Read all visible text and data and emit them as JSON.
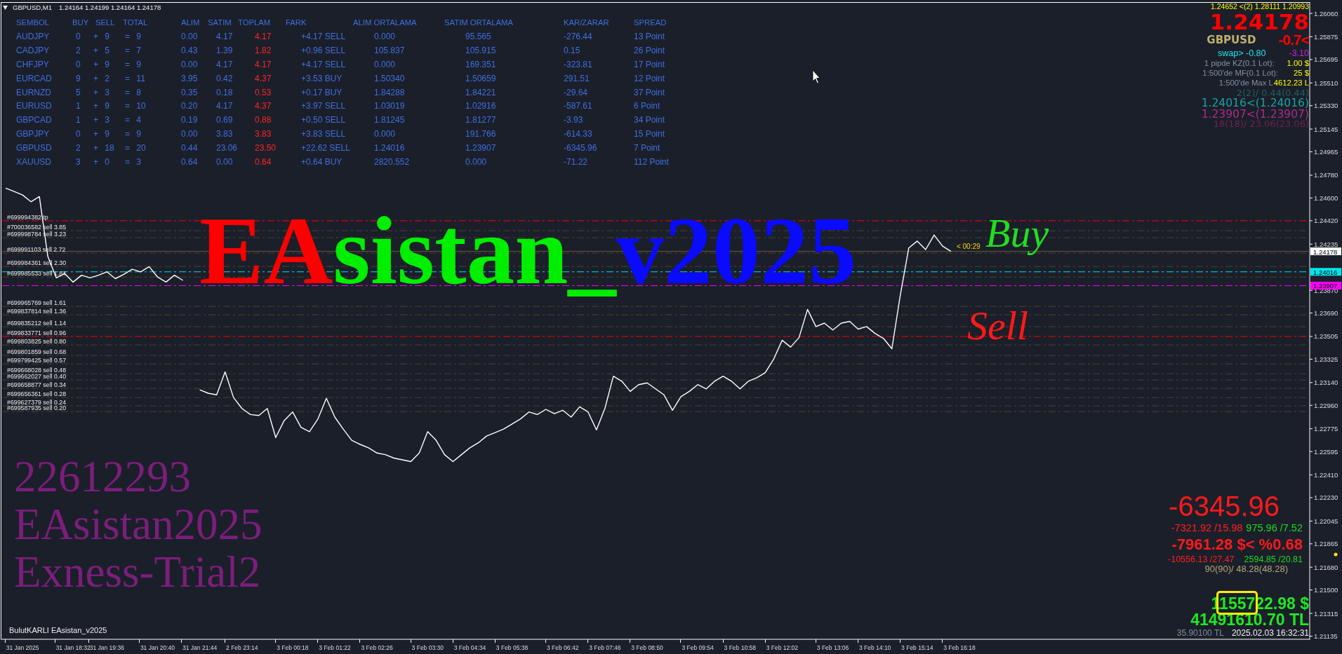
{
  "chart_header": {
    "symbol": "GBPUSD,M1",
    "ohlc": "1.24164 1.24199 1.24164 1.24178"
  },
  "positions_table": {
    "columns": [
      "SEMBOL",
      "BUY",
      "SELL",
      "TOTAL",
      "ALIM",
      "SATIM",
      "TOPLAM",
      "FARK",
      "ALIM ORTALAMA",
      "SATIM ORTALAMA",
      "KAR/ZARAR",
      "SPREAD"
    ],
    "rows": [
      {
        "cells": [
          "AUDJPY",
          "0",
          "+ 9",
          "= 9",
          "0.00",
          "4.17",
          "4.17",
          "+4.17 SELL",
          "0.000",
          "95.565",
          "-276.44",
          "13 Point"
        ]
      },
      {
        "cells": [
          "CADJPY",
          "2",
          "+ 5",
          "= 7",
          "0.43",
          "1.39",
          "1.82",
          "+0.96 SELL",
          "105.837",
          "105.915",
          "0.15",
          "26 Point"
        ]
      },
      {
        "cells": [
          "CHFJPY",
          "0",
          "+ 9",
          "= 9",
          "0.00",
          "4.17",
          "4.17",
          "+4.17 SELL",
          "0.000",
          "169.351",
          "-323.81",
          "17 Point"
        ]
      },
      {
        "cells": [
          "EURCAD",
          "9",
          "+ 2",
          "= 11",
          "3.95",
          "0.42",
          "4.37",
          "+3.53 BUY",
          "1.50340",
          "1.50659",
          "291.51",
          "12 Point"
        ]
      },
      {
        "cells": [
          "EURNZD",
          "5",
          "+ 3",
          "= 8",
          "0.35",
          "0.18",
          "0.53",
          "+0.17 BUY",
          "1.84288",
          "1.84221",
          "-29.64",
          "37 Point"
        ]
      },
      {
        "cells": [
          "EURUSD",
          "1",
          "+ 9",
          "= 10",
          "0.20",
          "4.17",
          "4.37",
          "+3.97 SELL",
          "1.03019",
          "1.02916",
          "-587.61",
          "6 Point"
        ]
      },
      {
        "cells": [
          "GBPCAD",
          "1",
          "+ 3",
          "= 4",
          "0.19",
          "0.69",
          "0.88",
          "+0.50 SELL",
          "1.81245",
          "1.81277",
          "-3.93",
          "34 Point"
        ]
      },
      {
        "cells": [
          "GBPJPY",
          "0",
          "+ 9",
          "= 9",
          "0.00",
          "3.83",
          "3.83",
          "+3.83 SELL",
          "0.000",
          "191.766",
          "-614.33",
          "15 Point"
        ]
      },
      {
        "cells": [
          "GBPUSD",
          "2",
          "+ 18",
          "= 20",
          "0.44",
          "23.06",
          "23.50",
          "+22.62 SELL",
          "1.24016",
          "1.23907",
          "-6345.96",
          "7 Point"
        ]
      },
      {
        "cells": [
          "XAUUSD",
          "3",
          "+ 0",
          "= 3",
          "0.64",
          "0.00",
          "0.64",
          "+0.64 BUY",
          "2820.552",
          "0.000",
          "-71.22",
          "112 Point"
        ]
      }
    ]
  },
  "symbol_panel": {
    "range_line": "1.24652 <(2) 1.28111 1.20993",
    "price": "1.24178",
    "symbol": "GBPUSD",
    "daily_change": "-0.7<",
    "swap_long": "swap> -0.80",
    "swap_short": "-3.10",
    "rows": [
      {
        "label": "1 pipde KZ(0.1 Lot):",
        "value": "1.00 $"
      },
      {
        "label": "1:500'de MF(0.1 Lot):",
        "value": "25 $"
      },
      {
        "label": "1:500'de Max L",
        "value": "4612.23 L"
      }
    ],
    "buy_summary": "2(2)/ 0.44(0.44)",
    "buy_average": "1.24016<(1.24016)",
    "sell_average": "1.23907<(1.23907)",
    "sell_summary": "18(18)/ 23.06(23.06)"
  },
  "chart_title": {
    "parts": [
      {
        "text": "EA",
        "color": "#ff0000"
      },
      {
        "text": "sistan_",
        "color": "#00ee00"
      },
      {
        "text": "v2025",
        "color": "#0a0aff"
      }
    ]
  },
  "handwritten_notes": [
    {
      "text": "Buy",
      "color": "#22dd22"
    },
    {
      "text": "Sell",
      "color": "#ff1a1a"
    }
  ],
  "chart": {
    "countdown": "< 00:29",
    "price_tags": [
      "1.24178",
      "1.24016",
      "1.23907"
    ],
    "chart_data": {
      "type": "line",
      "ylim": [
        1.2111,
        1.26149
      ],
      "categories": [
        null,
        null,
        "31 Jan 2025",
        null,
        null,
        null,
        null,
        null,
        "31 Jan 18:32",
        null,
        null,
        null,
        "31 Jan 19:36",
        null,
        null,
        null,
        null,
        null,
        "31 Jan 20:40",
        null,
        null,
        null,
        null,
        "31 Jan 21:44",
        null,
        null,
        null,
        null,
        "2 Feb 23:14",
        null,
        null,
        null,
        null,
        null,
        "3 Feb 00:18",
        null,
        null,
        null,
        null,
        "3 Feb 01:22",
        null,
        null,
        null,
        null,
        "3 Feb 02:26",
        null,
        null,
        null,
        null,
        null,
        "3 Feb 03:30",
        null,
        null,
        null,
        null,
        "3 Feb 04:34",
        null,
        null,
        null,
        null,
        "3 Feb 05:38",
        null,
        null,
        null,
        null,
        null,
        "3 Feb 06:42",
        null,
        null,
        null,
        null,
        "3 Feb 07:46",
        null,
        null,
        null,
        null,
        "3 Feb 08:50",
        null,
        null,
        null,
        null,
        null,
        "3 Feb 09:54",
        null,
        null,
        null,
        null,
        "3 Feb 10:58",
        null,
        null,
        null,
        null,
        "3 Feb 12:02",
        null,
        null,
        null,
        null,
        null,
        "3 Feb 13:06",
        null,
        null,
        null,
        null,
        "3 Feb 14:10",
        null,
        null,
        null,
        null,
        "3 Feb 15:14",
        null,
        null,
        null,
        null,
        "3 Feb 16:18",
        null,
        null,
        null,
        null,
        null,
        null,
        null,
        null,
        null,
        null,
        null,
        null,
        null,
        null,
        null,
        null,
        null,
        null,
        null,
        null,
        null,
        null,
        null,
        null,
        null,
        null,
        null,
        null,
        null,
        null,
        null,
        null,
        null,
        null,
        null,
        null,
        null,
        null,
        null,
        null,
        null
      ],
      "yticks": [
        {
          "value": 1.2606,
          "label": "1.26060"
        },
        {
          "value": 1.25875,
          "label": "1.25875"
        },
        {
          "value": 1.25695,
          "label": "1.25695"
        },
        {
          "value": 1.2551,
          "label": "1.25510"
        },
        {
          "value": 1.2533,
          "label": "1.25330"
        },
        {
          "value": 1.25145,
          "label": "1.25145"
        },
        {
          "value": 1.24965,
          "label": "1.24965"
        },
        {
          "value": 1.2478,
          "label": "1.24780"
        },
        {
          "value": 1.246,
          "label": "1.24600"
        },
        {
          "value": 1.2442,
          "label": "1.24420"
        },
        {
          "value": 1.24235,
          "label": "1.24235"
        },
        {
          "value": 1.2387,
          "label": "1.23870"
        },
        {
          "value": 1.2369,
          "label": "1.23690"
        },
        {
          "value": 1.23505,
          "label": "1.23505"
        },
        {
          "value": 1.23325,
          "label": "1.23325"
        },
        {
          "value": 1.2314,
          "label": "1.23140"
        },
        {
          "value": 1.2296,
          "label": "1.22960"
        },
        {
          "value": 1.22775,
          "label": "1.22775"
        },
        {
          "value": 1.22595,
          "label": "1.22595"
        },
        {
          "value": 1.2241,
          "label": "1.22410"
        },
        {
          "value": 1.2223,
          "label": "1.22230"
        },
        {
          "value": 1.22045,
          "label": "1.22045"
        },
        {
          "value": 1.21865,
          "label": "1.21865"
        },
        {
          "value": 1.2168,
          "label": "1.21680"
        },
        {
          "value": 1.215,
          "label": "1.21500"
        },
        {
          "value": 1.21315,
          "label": "1.21315"
        },
        {
          "value": 1.21135,
          "label": "1.21135"
        }
      ],
      "series": [
        {
          "color": "#ffffff",
          "values": [
            1.24678,
            1.24651,
            1.24624,
            1.2457,
            1.24611,
            1.24138,
            1.23969,
            1.24002,
            1.23935,
            1.23989,
            1.23969,
            1.23989,
            1.24016,
            1.23962,
            1.23996,
            1.24036,
            1.24016,
            1.24057,
            1.23975,
            1.23935,
            1.23989,
            1.23948,
            null,
            1.23083,
            1.23056,
            1.23043,
            1.23225,
            1.23022,
            1.22935,
            1.22887,
            1.2288,
            1.22935,
            1.22705,
            1.2284,
            1.22908,
            1.22786,
            1.22752,
            1.22853,
            1.23016,
            1.22867,
            1.22772,
            1.22684,
            1.22651,
            1.22624,
            1.22583,
            1.2257,
            1.22543,
            1.22529,
            1.22515,
            1.22583,
            1.22752,
            1.22684,
            1.2257,
            1.22515,
            1.2257,
            1.22624,
            1.22664,
            1.22718,
            1.22745,
            1.22772,
            1.22813,
            1.22853,
            1.22908,
            1.22887,
            1.22928,
            1.22894,
            1.22921,
            1.22867,
            1.22948,
            1.22908,
            1.22766,
            1.22935,
            1.23191,
            1.23151,
            1.2307,
            1.23124,
            1.23137,
            1.2309,
            1.23043,
            1.22921,
            1.23029,
            1.2307,
            1.23124,
            1.2309,
            1.23151,
            1.23191,
            1.23151,
            1.2309,
            1.23151,
            1.23178,
            1.23218,
            1.23327,
            1.23475,
            1.23421,
            1.23496,
            1.23719,
            1.23583,
            1.2361,
            1.23556,
            1.2361,
            1.23624,
            1.23563,
            1.23583,
            1.23529,
            1.23489,
            1.23408,
            1.23833,
            1.24205,
            1.24259,
            1.24192,
            1.24307,
            1.24219,
            1.24178,
            null,
            null,
            null,
            null,
            null,
            null,
            null,
            null,
            null,
            null,
            null,
            null,
            null,
            null,
            null,
            null,
            null,
            null,
            null,
            null,
            null,
            null,
            null,
            null,
            null,
            null,
            null,
            null,
            null,
            null,
            null,
            null,
            null,
            null,
            null,
            null,
            null,
            null,
            null,
            null,
            null,
            null
          ]
        }
      ],
      "ref_lines": [
        {
          "axis": "y",
          "value": 1.2442,
          "color": "#ff0000",
          "label": "#699994382 tp"
        },
        {
          "axis": "y",
          "value": 1.24341,
          "color": "#48432e",
          "label": "#700036582 sell 3.85"
        },
        {
          "axis": "y",
          "value": 1.24286,
          "color": "#48432e",
          "label": "#699998784 sell 3.23"
        },
        {
          "axis": "y",
          "value": 1.24164,
          "color": "#48432e",
          "label": "#699991103 sell 2.72"
        },
        {
          "axis": "y",
          "value": 1.24059,
          "color": "#48432e",
          "label": "#699984361 sell 2.30"
        },
        {
          "axis": "y",
          "value": 1.23975,
          "color": "#48432e",
          "label": "#699985533 sell 1.84"
        },
        {
          "axis": "y",
          "value": 1.23743,
          "color": "#48432e",
          "label": "#699965769 sell 1.61"
        },
        {
          "axis": "y",
          "value": 1.23676,
          "color": "#48432e",
          "label": "#699837814 sell 1.36"
        },
        {
          "axis": "y",
          "value": 1.23582,
          "color": "#48432e",
          "label": "#699835212 sell 1.14"
        },
        {
          "axis": "y",
          "value": 1.23505,
          "color": "#ff0000",
          "label": "#699833771 sell 0.96"
        },
        {
          "axis": "y",
          "value": 1.23438,
          "color": "#48432e",
          "label": "#699803825 sell 0.80"
        },
        {
          "axis": "y",
          "value": 1.23355,
          "color": "#48432e",
          "label": "#699801859 sell 0.68"
        },
        {
          "axis": "y",
          "value": 1.23288,
          "color": "#48432e",
          "label": "#699799425 sell 0.57"
        },
        {
          "axis": "y",
          "value": 1.2321,
          "color": "#48432e",
          "label": "#699668028 sell 0.48"
        },
        {
          "axis": "y",
          "value": 1.23161,
          "color": "#48432e",
          "label": "#699662027 sell 0.40"
        },
        {
          "axis": "y",
          "value": 1.23094,
          "color": "#48432e",
          "label": "#699658877 sell 0.34"
        },
        {
          "axis": "y",
          "value": 1.23022,
          "color": "#48432e",
          "label": "#699656361 sell 0.28"
        },
        {
          "axis": "y",
          "value": 1.22956,
          "color": "#48432e",
          "label": "#699627379 sell 0.24"
        },
        {
          "axis": "y",
          "value": 1.22911,
          "color": "#48432e",
          "label": "#699587935 sell 0.20"
        },
        {
          "axis": "y",
          "value": 1.24178,
          "color": "#6e5836"
        },
        {
          "axis": "y",
          "value": 1.24016,
          "color": "#00e5ee"
        },
        {
          "axis": "y",
          "value": 1.23907,
          "color": "#ff00ff"
        }
      ]
    }
  },
  "account_info": {
    "login": "22612293",
    "name": "EAsistan2025",
    "server": "Exness-Trial2"
  },
  "profit_panel": {
    "total": "-6345.96",
    "sell_detail": "-7321.92 /15.98",
    "buy_detail": "975.96 /7.52",
    "total_all": "-7961.28 $< %0.68",
    "sell_all": "-10556.13 /27.47",
    "buy_all": "2594.85 /20.81",
    "counts": "90(90)/ 48.28(48.28)",
    "balance_usd": "1155722.98 $",
    "balance_try": "41491610.70 TL",
    "rate": "35.90100 TL",
    "time": "2025.02.03 16:32:31"
  },
  "footer_label": "BulutKARLI EAsistan_v2025"
}
